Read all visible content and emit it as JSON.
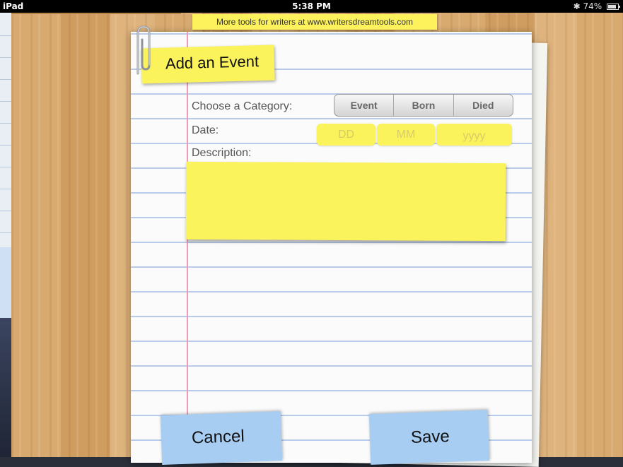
{
  "status_bar": {
    "device": "iPad",
    "time": "5:38 PM",
    "battery": "74%"
  },
  "banner": {
    "text": "More tools for writers at www.writersdreamtools.com"
  },
  "title": "Add an Event",
  "form": {
    "category_label": "Choose a Category:",
    "category_options": [
      "Event",
      "Born",
      "Died"
    ],
    "date_label": "Date:",
    "date_placeholders": {
      "day": "DD",
      "month": "MM",
      "year": "yyyy"
    },
    "description_label": "Description:",
    "description_value": ""
  },
  "buttons": {
    "cancel": "Cancel",
    "save": "Save"
  },
  "colors": {
    "sticky_yellow": "#fbf35b",
    "button_blue": "#a8cdf2",
    "margin_line": "#f19ab8",
    "ruled_line": "#b9cbe8"
  }
}
